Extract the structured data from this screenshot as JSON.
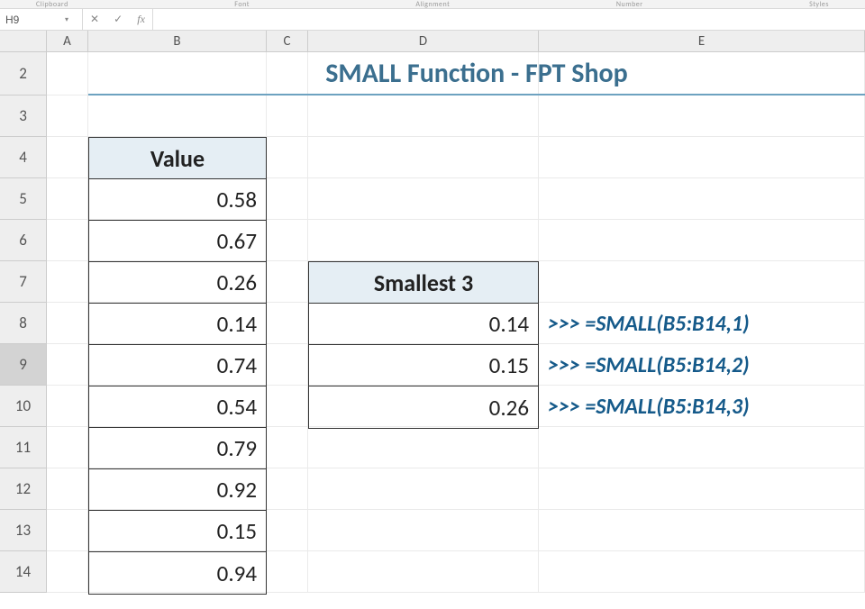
{
  "ribbon": {
    "labels": [
      "Clipboard",
      "Font",
      "Alignment",
      "Number",
      "Styles"
    ]
  },
  "nameBox": {
    "value": "H9"
  },
  "formulaBar": {
    "value": ""
  },
  "columns": [
    "A",
    "B",
    "C",
    "D",
    "E"
  ],
  "rows": [
    "2",
    "3",
    "4",
    "5",
    "6",
    "7",
    "8",
    "9",
    "10",
    "11",
    "12",
    "13",
    "14"
  ],
  "selectedRow": "9",
  "title": "SMALL Function - FPT Shop",
  "valueTable": {
    "header": "Value",
    "values": [
      "0.58",
      "0.67",
      "0.26",
      "0.14",
      "0.74",
      "0.54",
      "0.79",
      "0.92",
      "0.15",
      "0.94"
    ]
  },
  "small3Table": {
    "header": "Smallest 3",
    "values": [
      "0.14",
      "0.15",
      "0.26"
    ]
  },
  "annotations": [
    ">>> =SMALL(B5:B14,1)",
    ">>> =SMALL(B5:B14,2)",
    ">>> =SMALL(B5:B14,3)"
  ],
  "chart_data": {
    "type": "table",
    "title": "SMALL Function - FPT Shop",
    "series": [
      {
        "name": "Value",
        "values": [
          0.58,
          0.67,
          0.26,
          0.14,
          0.74,
          0.54,
          0.79,
          0.92,
          0.15,
          0.94
        ]
      },
      {
        "name": "Smallest 3",
        "values": [
          0.14,
          0.15,
          0.26
        ]
      }
    ],
    "formulas": [
      "=SMALL(B5:B14,1)",
      "=SMALL(B5:B14,2)",
      "=SMALL(B5:B14,3)"
    ]
  }
}
